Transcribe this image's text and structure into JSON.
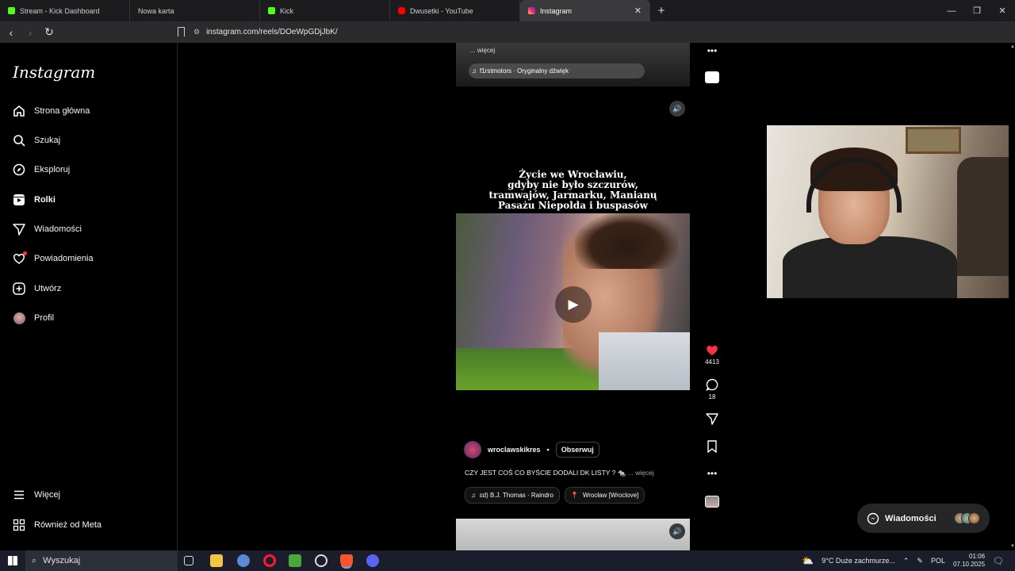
{
  "browser": {
    "tabs": [
      {
        "title": "Stream - Kick Dashboard",
        "favicon_color": "#53fc18"
      },
      {
        "title": "Nowa karta",
        "favicon_color": ""
      },
      {
        "title": "Kick",
        "favicon_color": "#53fc18"
      },
      {
        "title": "Dwusetki - YouTube",
        "favicon_color": "#ff0000"
      },
      {
        "title": "Instagram",
        "favicon_color": "#e1306c",
        "active": true
      }
    ],
    "new_tab_icon": "plus-icon",
    "url": "instagram.com/reels/DOeWpGDjJbK/"
  },
  "sidebar": {
    "logo": "Instagram",
    "items": [
      {
        "label": "Strona główna",
        "icon": "home-icon"
      },
      {
        "label": "Szukaj",
        "icon": "search-icon"
      },
      {
        "label": "Eksploruj",
        "icon": "compass-icon"
      },
      {
        "label": "Rolki",
        "icon": "reels-icon",
        "active": true
      },
      {
        "label": "Wiadomości",
        "icon": "send-icon"
      },
      {
        "label": "Powiadomienia",
        "icon": "heart-icon"
      },
      {
        "label": "Utwórz",
        "icon": "plus-square-icon"
      },
      {
        "label": "Profil",
        "icon": "avatar-icon"
      }
    ],
    "bottom_items": [
      {
        "label": "Więcej",
        "icon": "menu-icon"
      },
      {
        "label": "Również od Meta",
        "icon": "meta-icon"
      }
    ]
  },
  "prev_post": {
    "caption": "... więcej",
    "audio": "f1rstmotors · Oryginalny dźwięk"
  },
  "reel": {
    "overlay_text_lines": [
      "Życie we Wrocławiu,",
      "gdyby nie było szczurów,",
      "tramwajów, Jarmarku, Manianų",
      "Pasażu Niepolda i buspasów"
    ],
    "author": "wroclawskikres",
    "separator": "•",
    "follow_label": "Obserwuj",
    "caption": "CZY JEST COŚ CO BYŚCIE DODALI DK LISTY ? 🐀",
    "caption_more": "... więcej",
    "audio": "ɛd)   B.J. Thomas · Raindro",
    "location": "Wrocław [Wroclove]"
  },
  "actions": {
    "likes": "4413",
    "comments": "18"
  },
  "messages_bar": {
    "label": "Wiadomości"
  },
  "taskbar": {
    "search_placeholder": "Wyszukaj",
    "weather": "9°C  Duże zachmurze...",
    "language": "POL",
    "time": "01:06",
    "date": "07.10.2025"
  },
  "colors": {
    "like": "#ff3040",
    "sidebar_border": "#262626"
  }
}
